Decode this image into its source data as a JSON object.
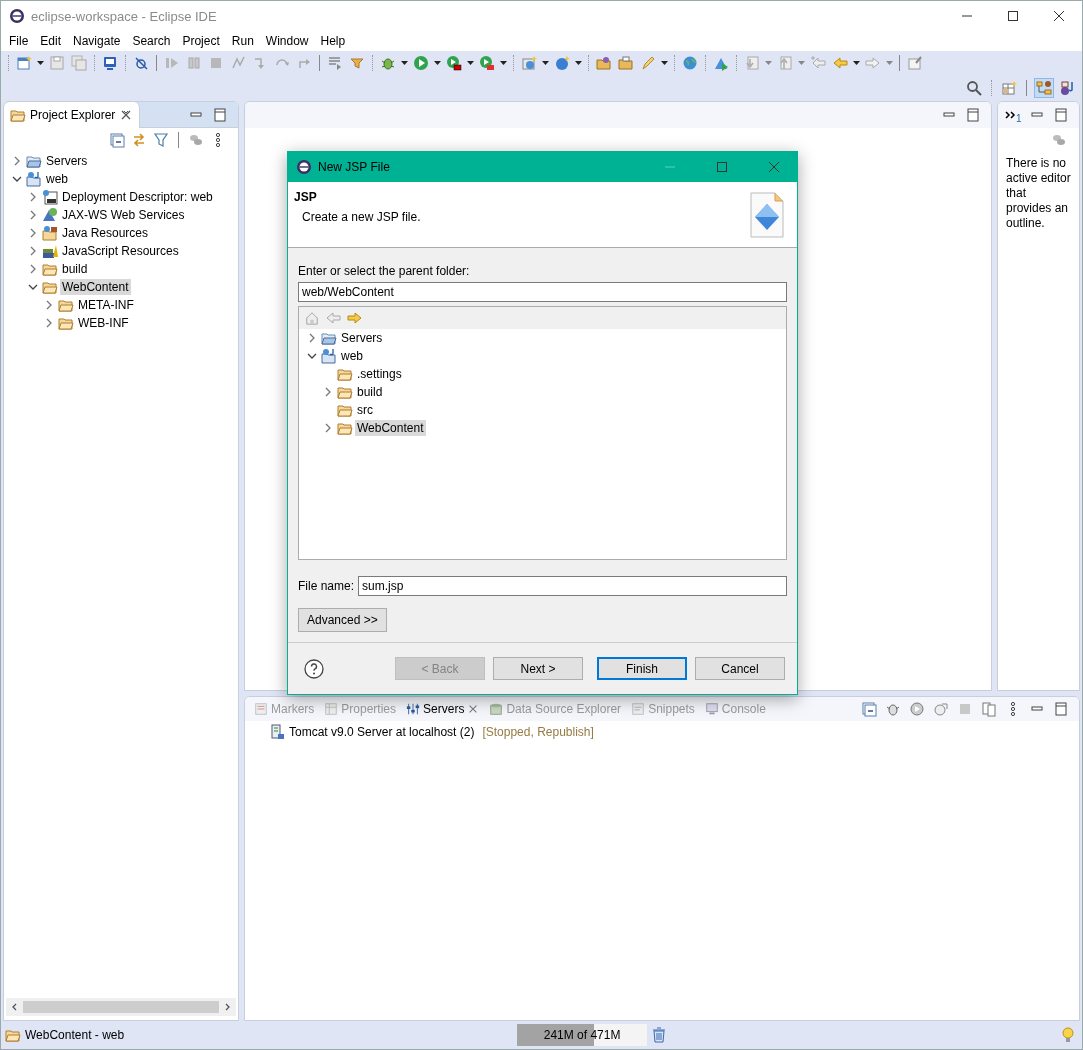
{
  "window": {
    "title": "eclipse-workspace - Eclipse IDE"
  },
  "menu": [
    "File",
    "Edit",
    "Navigate",
    "Search",
    "Project",
    "Run",
    "Window",
    "Help"
  ],
  "project_explorer": {
    "title": "Project Explorer",
    "tree": [
      {
        "label": "Servers",
        "kind": "folder-open",
        "has_children": true,
        "expanded": false,
        "selected": false
      },
      {
        "label": "web",
        "kind": "project",
        "has_children": true,
        "expanded": true,
        "selected": false,
        "children": [
          {
            "label": "Deployment Descriptor: web",
            "kind": "descriptor",
            "has_children": true,
            "expanded": false,
            "selected": false
          },
          {
            "label": "JAX-WS Web Services",
            "kind": "webservice",
            "has_children": true,
            "expanded": false,
            "selected": false
          },
          {
            "label": "Java Resources",
            "kind": "javares",
            "has_children": true,
            "expanded": false,
            "selected": false
          },
          {
            "label": "JavaScript Resources",
            "kind": "jsres",
            "has_children": true,
            "expanded": false,
            "selected": false
          },
          {
            "label": "build",
            "kind": "folder",
            "has_children": true,
            "expanded": false,
            "selected": false
          },
          {
            "label": "WebContent",
            "kind": "folder",
            "has_children": true,
            "expanded": true,
            "selected": true,
            "children": [
              {
                "label": "META-INF",
                "kind": "folder",
                "has_children": true,
                "expanded": false,
                "selected": false
              },
              {
                "label": "WEB-INF",
                "kind": "folder",
                "has_children": true,
                "expanded": false,
                "selected": false
              }
            ]
          }
        ]
      }
    ]
  },
  "outline": {
    "badge": "1",
    "message": "There is no active editor that provides an outline."
  },
  "servers_panel": {
    "tabs": [
      {
        "label": "Markers",
        "kind": "markers",
        "selected": false
      },
      {
        "label": "Properties",
        "kind": "properties",
        "selected": false
      },
      {
        "label": "Servers",
        "kind": "servers",
        "selected": true
      },
      {
        "label": "Data Source Explorer",
        "kind": "datasource",
        "selected": false
      },
      {
        "label": "Snippets",
        "kind": "snippets",
        "selected": false
      },
      {
        "label": "Console",
        "kind": "console",
        "selected": false
      }
    ],
    "rows": [
      {
        "name": "Tomcat v9.0 Server at localhost (2)",
        "status": "[Stopped, Republish]"
      }
    ]
  },
  "status_bar": {
    "selection": "WebContent - web",
    "heap": {
      "text": "241M of 471M",
      "level": 0.59
    }
  },
  "dialog": {
    "title": "New JSP File",
    "heading": "JSP",
    "description": "Create a new JSP file.",
    "folder_label": "Enter or select the parent folder:",
    "folder_value": "web/WebContent",
    "tree": [
      {
        "label": "Servers",
        "kind": "folder-open",
        "has_children": true,
        "expanded": false,
        "selected": false
      },
      {
        "label": "web",
        "kind": "project",
        "has_children": true,
        "expanded": true,
        "selected": false,
        "children": [
          {
            "label": ".settings",
            "kind": "folder",
            "has_children": false,
            "selected": false
          },
          {
            "label": "build",
            "kind": "folder",
            "has_children": true,
            "expanded": false,
            "selected": false
          },
          {
            "label": "src",
            "kind": "folder",
            "has_children": false,
            "selected": false
          },
          {
            "label": "WebContent",
            "kind": "folder",
            "has_children": true,
            "expanded": false,
            "selected": true
          }
        ]
      }
    ],
    "file_name_label": "File name:",
    "file_name_value": "sum.jsp",
    "advanced_button": "Advanced >>",
    "buttons": [
      {
        "label": "< Back",
        "disabled": true,
        "default": false
      },
      {
        "label": "Next >",
        "disabled": false,
        "default": false
      },
      {
        "label": "Finish",
        "disabled": false,
        "default": true
      },
      {
        "label": "Cancel",
        "disabled": false,
        "default": false
      }
    ]
  }
}
